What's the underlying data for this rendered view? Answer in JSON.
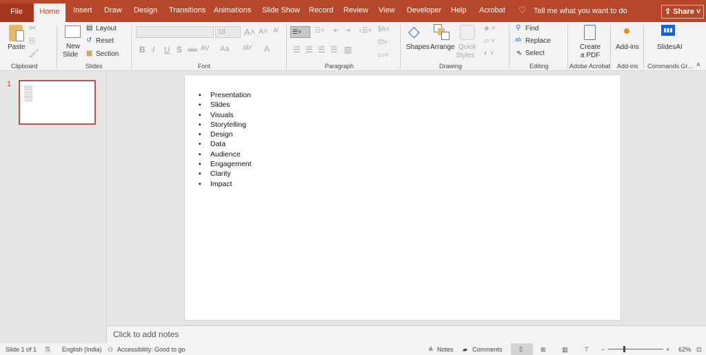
{
  "tabs": {
    "file": "File",
    "items": [
      "Home",
      "Insert",
      "Draw",
      "Design",
      "Transitions",
      "Animations",
      "Slide Show",
      "Record",
      "Review",
      "View",
      "Developer",
      "Help",
      "Acrobat"
    ],
    "tell_me": "Tell me what you want to do",
    "share": "Share"
  },
  "ribbon": {
    "clipboard": {
      "paste": "Paste",
      "label": "Clipboard"
    },
    "slides": {
      "new_slide_1": "New",
      "new_slide_2": "Slide",
      "layout": "Layout",
      "reset": "Reset",
      "section": "Section",
      "label": "Slides"
    },
    "font": {
      "font_name": "",
      "font_size": "18",
      "bold": "B",
      "italic": "I",
      "underline": "U",
      "shadow": "S",
      "strike": "abc",
      "spacing": "AV",
      "case": "Aa",
      "color": "A",
      "label": "Font"
    },
    "paragraph": {
      "label": "Paragraph"
    },
    "drawing": {
      "shapes": "Shapes",
      "arrange": "Arrange",
      "quick_1": "Quick",
      "quick_2": "Styles",
      "label": "Drawing"
    },
    "editing": {
      "find": "Find",
      "replace": "Replace",
      "select": "Select",
      "label": "Editing"
    },
    "acrobat": {
      "create_1": "Create",
      "create_2": "a PDF",
      "label": "Adobe Acrobat"
    },
    "addins": {
      "addins": "Add-ins",
      "label": "Add-ins"
    },
    "commands": {
      "slidesai": "SlidesAI",
      "label": "Commands Gr..."
    },
    "accent": "#b7472a"
  },
  "thumbnails": {
    "number": "1"
  },
  "slide": {
    "bullets": [
      "Presentation",
      "Slides",
      "Visuals",
      "Storytelling",
      "Design",
      "Data",
      "Audience",
      "Engagement",
      "Clarity",
      "Impact"
    ]
  },
  "notes": {
    "placeholder": "Click to add notes"
  },
  "status": {
    "slide": "Slide 1 of 1",
    "language": "English (India)",
    "accessibility": "Accessibility: Good to go",
    "notes": "Notes",
    "comments": "Comments",
    "zoom": "62%",
    "zoom_percent": 62
  }
}
